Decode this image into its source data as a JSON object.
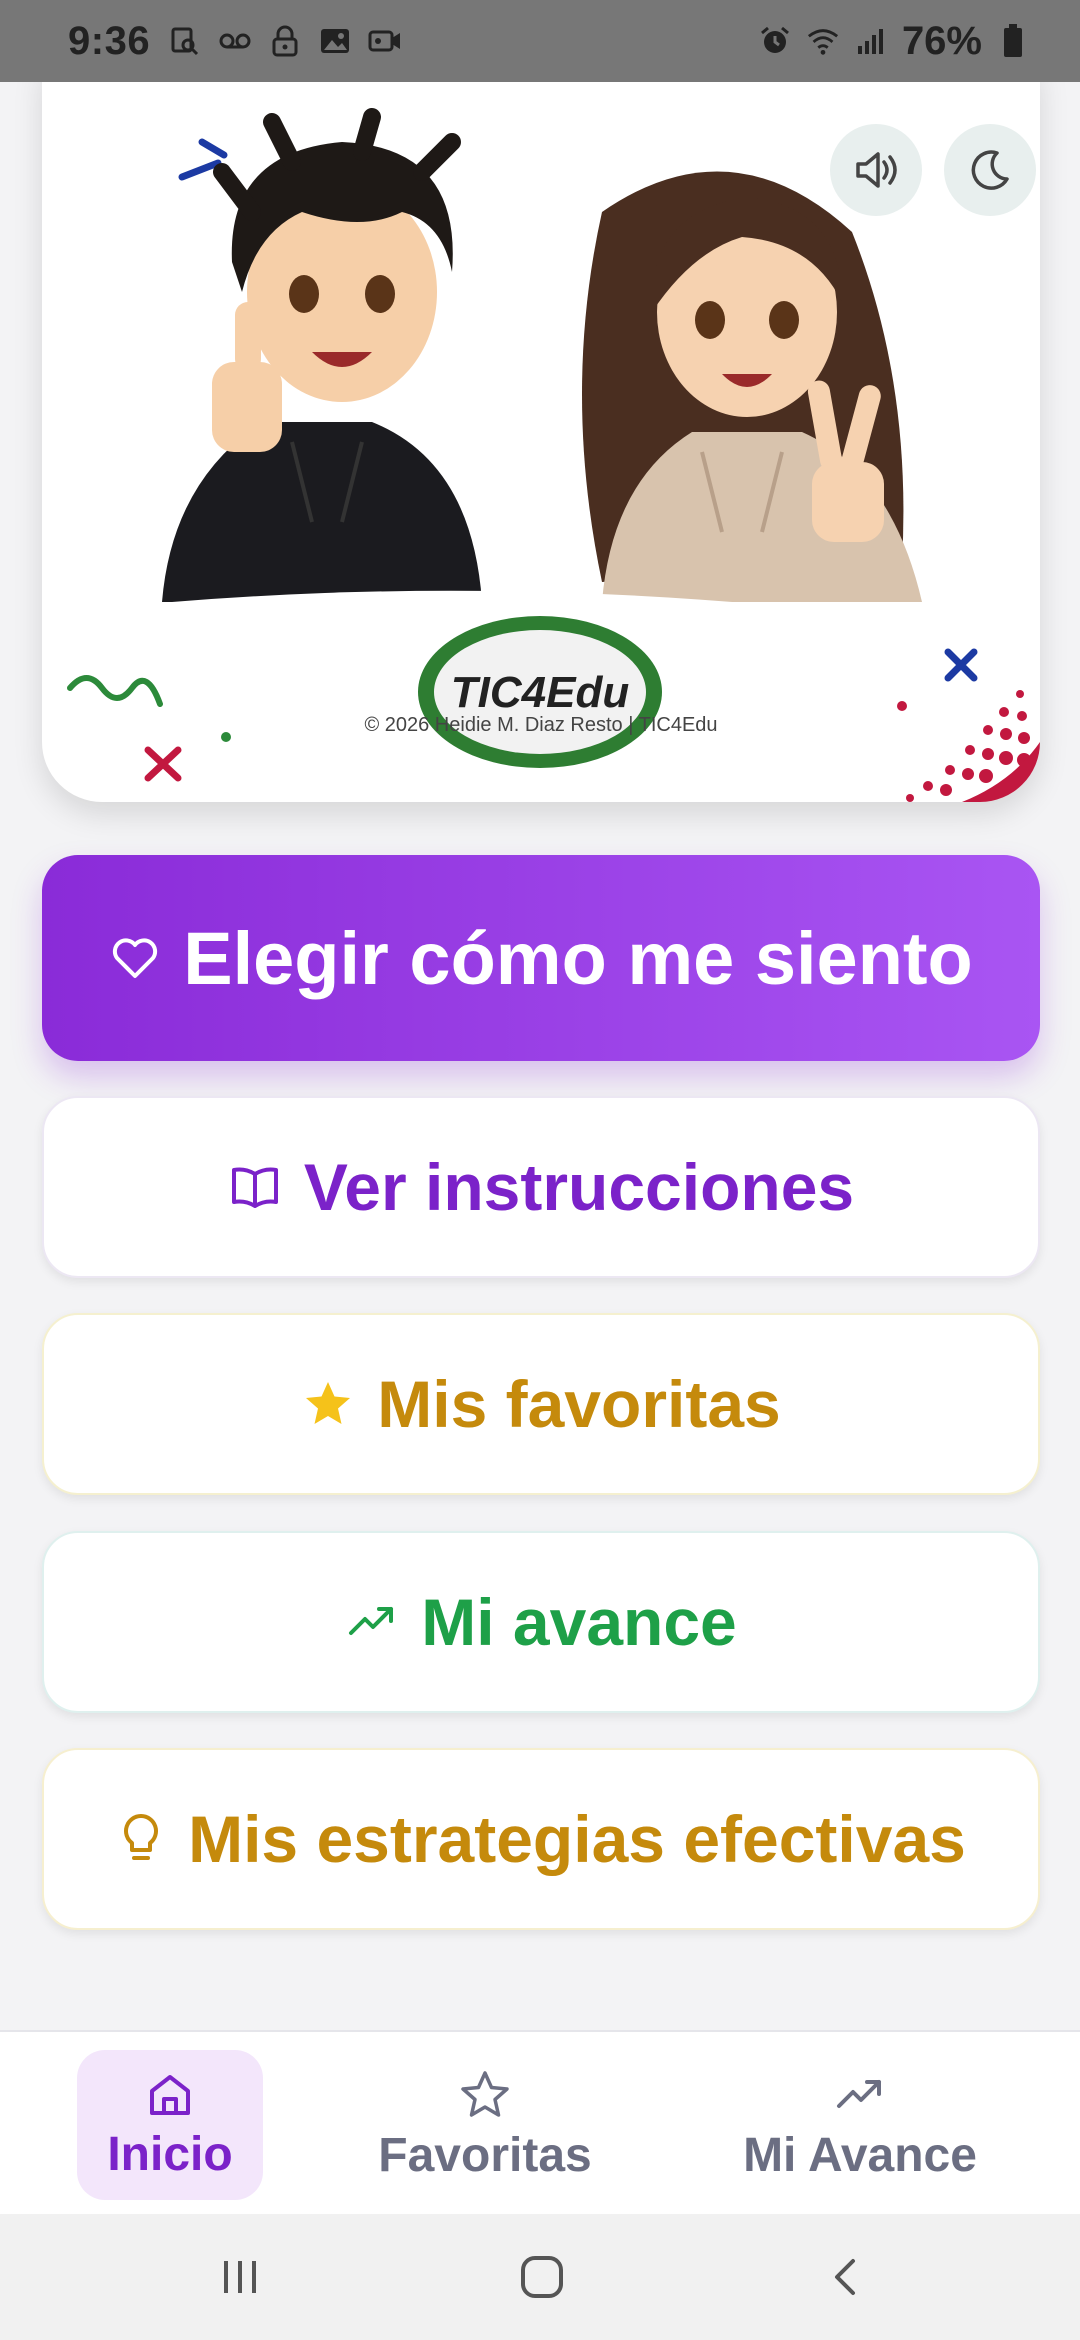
{
  "status_bar": {
    "time": "9:36",
    "battery": "76%",
    "icons": [
      "search-doc-icon",
      "voicemail-icon",
      "lock-icon",
      "image-icon",
      "video-call-icon",
      "alarm-icon",
      "wifi-icon",
      "signal-icon",
      "battery-icon"
    ]
  },
  "hero": {
    "logo_text": "TIC4Edu",
    "credit": "© 2026 Heidie M. Diaz Resto | TIC4Edu",
    "illustration": "two-anime-students-thumbs-up-peace-sign"
  },
  "controls": {
    "sound_icon": "speaker-icon",
    "theme_icon": "moon-icon"
  },
  "actions": {
    "primary_label": "Elegir cómo me siento",
    "instructions_label": "Ver instrucciones",
    "favorites_label": "Mis favoritas",
    "progress_label": "Mi avance",
    "strategies_label": "Mis estrategias efectivas"
  },
  "bottom_nav": {
    "items": [
      {
        "label": "Inicio",
        "icon": "home-icon",
        "active": true
      },
      {
        "label": "Favoritas",
        "icon": "star-icon",
        "active": false
      },
      {
        "label": "Mi Avance",
        "icon": "trending-up-icon",
        "active": false
      }
    ]
  },
  "colors": {
    "primary": "#8a2bd8",
    "instructions": "#7b22c9",
    "favorites": "#c58a0c",
    "progress": "#1ea048"
  }
}
